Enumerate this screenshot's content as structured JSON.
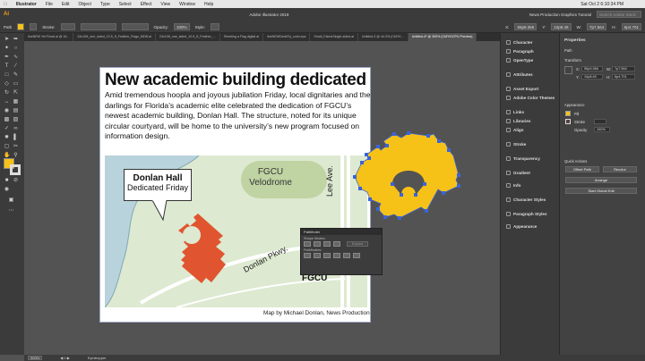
{
  "menubar": {
    "app": "Illustrator",
    "items": [
      "File",
      "Edit",
      "Object",
      "Type",
      "Select",
      "Effect",
      "View",
      "Window",
      "Help"
    ],
    "center_title": "Adobe Illustrator 2019",
    "workspace": "News Production Graphics Tutorial",
    "search_placeholder": "Search Adobe Stock",
    "clock": "Sat Oct 2  6:10:34 PM"
  },
  "control_bar": {
    "object_type": "Path",
    "stroke_label": "Stroke:",
    "opacity_label": "Opacity:",
    "opacity_value": "100%",
    "style_label": "Style:",
    "x_label": "X:",
    "x_value": "55p9.366",
    "y_label": "Y:",
    "y_value": "10p8.49",
    "w_label": "W:",
    "w_value": "7p7.564",
    "h_label": "H:",
    "h_value": "6p4.701"
  },
  "document_tabs": [
    "lineNEW Yet Floral.ai @ 16...",
    "24x10ft_one_sided_10.5_ft_Feather_Flags_NEW.ai",
    "24x10ft_one_sided_10.5_ft_Feather_...",
    "Sheeting a Flag digital.ai",
    "lineNEWDeckFly_color.eps",
    "Small_FabricSingle-sided.ai",
    "Untitled-3 @ 44.3% (CMYK...",
    "Untitled-4* @ 300% (CMYK/CPU Preview)"
  ],
  "graphic": {
    "headline": "New academic building dedicated",
    "body": "Amid tremendous hoopla and joyous jubilation Friday, local dignitaries and the darlings for Florida’s academic elite celebrated the dedication of FGCU’s newest academic building, Donlan Hall. The structure, noted for its unique circular courtyard, will be home to the university’s new program focused on information design.",
    "callout_title": "Donlan Hall",
    "callout_sub": "Dedicated Friday",
    "velodrome": "FGCU\nVelodrome",
    "road1": "Donlan Pkwy.",
    "road2": "Lee Ave.",
    "fgcu": "FGCU",
    "credit": "Map by Michael Donlan, News Production"
  },
  "pathfinder": {
    "title": "Pathfinder",
    "shape_modes": "Shape Modes:",
    "pathfinders": "Pathfinders:",
    "expand": "Expand"
  },
  "panels": [
    {
      "label": "Character",
      "icon": "character-icon"
    },
    {
      "label": "Paragraph",
      "icon": "paragraph-icon"
    },
    {
      "label": "OpenType",
      "icon": "opentype-icon"
    },
    {
      "label": "Attributes",
      "icon": "attributes-icon"
    },
    {
      "label": "Asset Export",
      "icon": "asset-export-icon"
    },
    {
      "label": "Adobe Color Themes",
      "icon": "color-themes-icon"
    },
    {
      "label": "Links",
      "icon": "links-icon"
    },
    {
      "label": "Libraries",
      "icon": "libraries-icon"
    },
    {
      "label": "Align",
      "icon": "align-icon"
    },
    {
      "label": "Stroke",
      "icon": "stroke-icon"
    },
    {
      "label": "Transparency",
      "icon": "transparency-icon"
    },
    {
      "label": "Gradient",
      "icon": "gradient-icon"
    },
    {
      "label": "Info",
      "icon": "info-icon"
    },
    {
      "label": "Character Styles",
      "icon": "char-styles-icon"
    },
    {
      "label": "Paragraph Styles",
      "icon": "para-styles-icon"
    },
    {
      "label": "Appearance",
      "icon": "appearance-icon"
    }
  ],
  "properties": {
    "title": "Properties",
    "section": "Path",
    "transform": "Transform",
    "x_label": "X:",
    "y_label": "Y:",
    "w_label": "W:",
    "h_label": "H:",
    "appearance": "Appearance",
    "fill": "Fill",
    "stroke": "Stroke",
    "opacity": "Opacity",
    "opacity_value": "100%",
    "quick_actions": "Quick Actions",
    "btn_offset": "Offset Path",
    "btn_recolor": "Recolor",
    "btn_arrange": "Arrange",
    "btn_global": "Start Global Edit"
  },
  "status_bar": {
    "zoom": "300%",
    "tool": "Eyedropper"
  },
  "colors": {
    "building": "#e0552f",
    "selection_fill": "#f6c218",
    "selection_handles": "#3a64d8",
    "map_green": "#dde9d0",
    "velodrome": "#bfd3a3",
    "water": "#b9d3dc"
  }
}
